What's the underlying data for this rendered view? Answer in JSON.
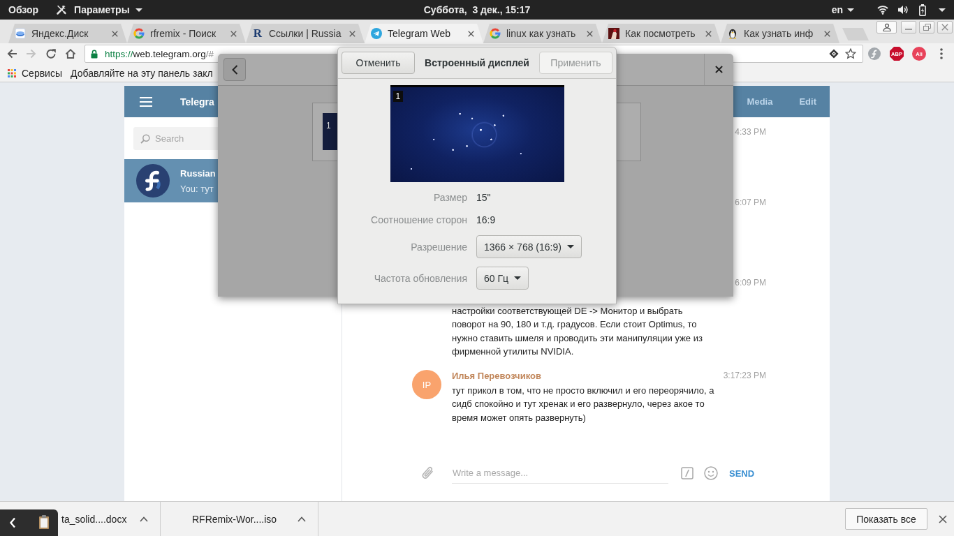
{
  "top_bar": {
    "activities": "Обзор",
    "app_menu": "Параметры",
    "clock": "Суббота,  3 дек., 15:17",
    "input_source": "en"
  },
  "browser": {
    "tabs": [
      {
        "title": "Яндекс.Диск",
        "kind": "disk",
        "selected": false
      },
      {
        "title": "rfremix - Поиск",
        "kind": "google",
        "selected": false
      },
      {
        "title": "Ссылки | Russia",
        "kind": "letter",
        "logo_letter": "R",
        "selected": false
      },
      {
        "title": "Telegram Web",
        "kind": "telegram",
        "selected": true
      },
      {
        "title": "linux как узнать",
        "kind": "google",
        "selected": false
      },
      {
        "title": "Как посмотреть",
        "kind": "picture",
        "selected": false
      },
      {
        "title": "Как узнать инф",
        "kind": "penguin",
        "selected": false
      }
    ],
    "nav": [
      {
        "kind": "back",
        "disabled": false
      },
      {
        "kind": "forward",
        "disabled": true
      },
      {
        "kind": "reload",
        "disabled": false
      },
      {
        "kind": "home",
        "disabled": false
      }
    ],
    "address": {
      "scheme": "https://",
      "host": "web.telegram.org",
      "rest": "/#"
    },
    "extensions": [
      {
        "kind": "fedora"
      },
      {
        "kind": "blocker",
        "label": "ABP"
      },
      {
        "kind": "shop",
        "label": "Ali"
      }
    ],
    "bookmarks": [
      {
        "kind": "apps",
        "label": "Сервисы"
      },
      {
        "kind": "hint",
        "label": "Добавляйте на эту панель закл"
      }
    ]
  },
  "telegram": {
    "header": {
      "title": "Telegra",
      "actions": [
        "Media",
        "Edit"
      ]
    },
    "search": {
      "placeholder": "Search"
    },
    "dialogs": [
      {
        "name": "Russian",
        "preview": "You: тут",
        "selected": true
      }
    ],
    "messages": [
      {
        "time": "4:33 PM"
      },
      {
        "time": "6:07 PM"
      },
      {
        "time": "6:09 PM",
        "text": "настройки соответствующей DE -> Монитор и выбрать поворот на 90, 180 и т.д. градусов. Если стоит Optimus, то нужно ставить шмеля и проводить эти манипуляции уже из фирменной утилиты NVIDIA."
      },
      {
        "author": "Илья Перевозчиков",
        "initials": "IP",
        "color": "#f9a36d",
        "time": "3:17:23 PM",
        "text": "тут прикол в том, что не просто включил и его переорячило, а сидб спокойно и тут хренак и его развернуло, через акое то время может опять развернуть)"
      }
    ],
    "composer": {
      "placeholder": "Write a message...",
      "send": "SEND"
    }
  },
  "settings_window": {
    "monitor_label": "1"
  },
  "display_dialog": {
    "cancel": "Отменить",
    "title": "Встроенный дисплей",
    "apply": {
      "label": "Применить",
      "disabled": true
    },
    "monitor_label": "1",
    "rows": [
      {
        "kind": "text",
        "label": "Размер",
        "value": "15\""
      },
      {
        "kind": "text",
        "label": "Соотношение сторон",
        "value": "16:9"
      },
      {
        "kind": "dropdown",
        "label": "Разрешение",
        "value": "1366 × 768 (16:9)"
      },
      {
        "kind": "dropdown",
        "label": "Частота обновления",
        "value": "60 Гц"
      }
    ]
  },
  "downloads": {
    "items": [
      {
        "name": "ta_solid....docx",
        "kind": "document"
      },
      {
        "name": "RFRemix-Wor....iso",
        "kind": "image"
      }
    ],
    "show_all": "Показать все"
  }
}
